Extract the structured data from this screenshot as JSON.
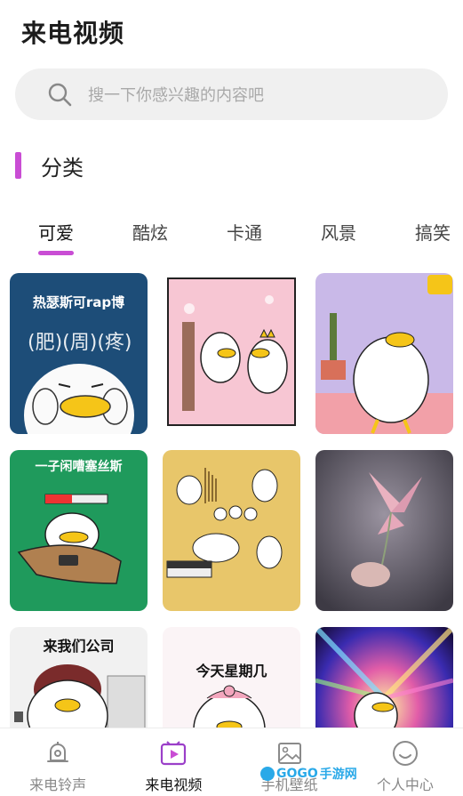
{
  "header": {
    "title": "来电视频"
  },
  "search": {
    "placeholder": "搜一下你感兴趣的内容吧",
    "icon": "search-icon"
  },
  "section": {
    "title": "分类",
    "accent": "#c94dd4"
  },
  "tabs": [
    {
      "label": "可爱",
      "active": true
    },
    {
      "label": "酷炫",
      "active": false
    },
    {
      "label": "卡通",
      "active": false
    },
    {
      "label": "风景",
      "active": false
    },
    {
      "label": "搞笑",
      "active": false
    }
  ],
  "cards": [
    {
      "caption": "热瑟斯可rap博",
      "subcaption": "",
      "bg": "#1d4d78"
    },
    {
      "caption": "",
      "subcaption": "",
      "bg": "#f7c6d3"
    },
    {
      "caption": "",
      "subcaption": "",
      "bg": "#c9b9e8"
    },
    {
      "caption": "一子闲嘈塞丝斯",
      "subcaption": "",
      "bg": "#1f9a5c"
    },
    {
      "caption": "",
      "subcaption": "",
      "bg": "#e8c66a"
    },
    {
      "caption": "",
      "subcaption": "",
      "bg": "#5a5660"
    },
    {
      "caption": "来我们公司",
      "subcaption": "",
      "bg": "#f1f1f1"
    },
    {
      "caption": "今天星期几",
      "subcaption": "",
      "bg": "#fbf4f6"
    },
    {
      "caption": "",
      "subcaption": "",
      "bg": "#2a1a4a"
    }
  ],
  "nav": [
    {
      "label": "来电铃声",
      "icon": "bell-icon",
      "active": false
    },
    {
      "label": "来电视频",
      "icon": "video-icon",
      "active": true
    },
    {
      "label": "手机壁纸",
      "icon": "image-icon",
      "active": false
    },
    {
      "label": "个人中心",
      "icon": "smile-icon",
      "active": false
    }
  ],
  "watermark": {
    "brand": "GOGO",
    "text": "手游网"
  }
}
